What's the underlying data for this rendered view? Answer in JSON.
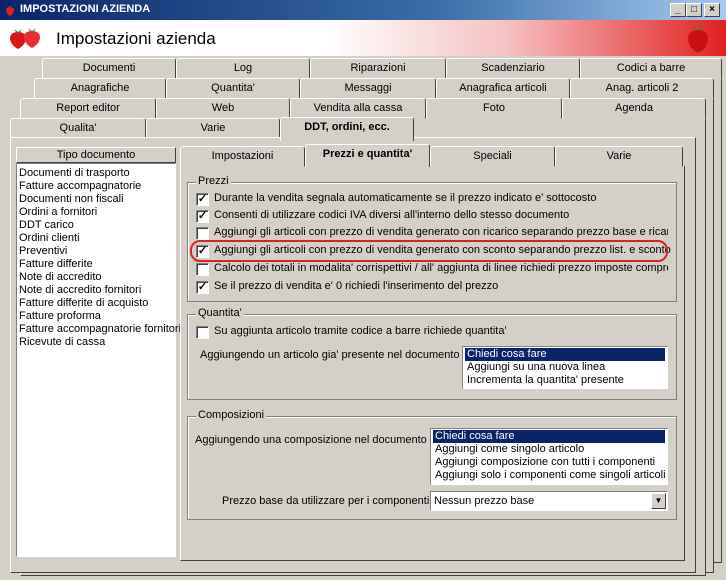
{
  "window": {
    "title": "IMPOSTAZIONI AZIENDA",
    "header": "Impostazioni azienda",
    "minimize_glyph": "_",
    "maximize_glyph": "□",
    "close_glyph": "×"
  },
  "top_tabs": {
    "row1": [
      "Documenti",
      "Log",
      "Riparazioni",
      "Scadenziario",
      "Codici a barre"
    ],
    "row2": [
      "Anagrafiche",
      "Quantita'",
      "Messaggi",
      "Anagrafica articoli",
      "Anag. articoli 2"
    ],
    "row3": [
      "Report editor",
      "Web",
      "Vendita alla cassa",
      "Foto",
      "Agenda"
    ],
    "row4": [
      "Qualita'",
      "Varie",
      "DDT, ordini, ecc."
    ]
  },
  "doc_list": {
    "title": "Tipo documento",
    "items": [
      "Documenti di trasporto",
      "Fatture accompagnatorie",
      "Documenti non fiscali",
      "Ordini a fornitori",
      "DDT carico",
      "Ordini clienti",
      "Preventivi",
      "Fatture differite",
      "Note di accredito",
      "Note di accredito fornitori",
      "Fatture differite di acquisto",
      "Fatture proforma",
      "Fatture accompagnatorie fornitori",
      "Ricevute di cassa"
    ]
  },
  "inner_tabs": [
    "Impostazioni",
    "Prezzi e quantita'",
    "Speciali",
    "Varie"
  ],
  "prezzi": {
    "title": "Prezzi",
    "check_glyph": "✓",
    "options": [
      {
        "label": "Durante la vendita segnala automaticamente se il prezzo indicato e' sottocosto",
        "checked": true
      },
      {
        "label": "Consenti di utilizzare codici IVA diversi all'interno dello stesso documento",
        "checked": true
      },
      {
        "label": "Aggiungi gli articoli con prezzo di vendita generato con ricarico separando prezzo base e ricarico",
        "checked": false
      },
      {
        "label": "Aggiungi gli articoli con prezzo di vendita generato con sconto separando prezzo list. e sconto",
        "checked": true
      },
      {
        "label": "Calcolo dei totali in modalita' corrispettivi / all' aggiunta di linee richiedi prezzo imposte comprese",
        "checked": false
      },
      {
        "label": "Se il prezzo di vendita e' 0 richiedi l'inserimento del prezzo",
        "checked": true
      }
    ]
  },
  "quantita": {
    "title": "Quantita'",
    "barcode_label": "Su aggiunta articolo tramite codice a barre richiede quantita'",
    "barcode_checked": false,
    "existing_label": "Aggiungendo un articolo gia' presente nel documento :",
    "existing_options": [
      "Chiedi cosa fare",
      "Aggiungi su una nuova linea",
      "Incrementa la quantita' presente"
    ],
    "existing_selected": 0
  },
  "composizioni": {
    "title": "Composizioni",
    "add_label": "Aggiungendo una composizione nel documento :",
    "add_options": [
      "Chiedi cosa fare",
      "Aggiungi come singolo articolo",
      "Aggiungi composizione con tutti i componenti",
      "Aggiungi solo i componenti come singoli articoli"
    ],
    "add_selected": 0,
    "base_price_label": "Prezzo base da utilizzare per i componenti :",
    "base_price_value": "Nessun prezzo base"
  },
  "colors": {
    "highlight": "#e02020",
    "selection": "#0a246a",
    "face": "#d4d0c8"
  }
}
